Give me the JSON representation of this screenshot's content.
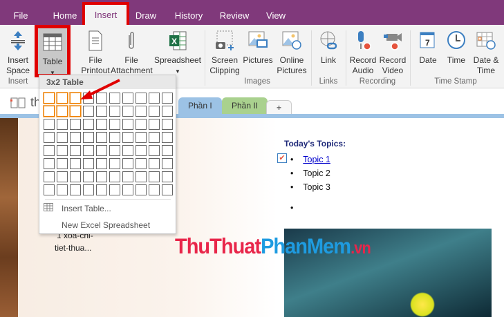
{
  "tabs": [
    "File",
    "Home",
    "Insert",
    "Draw",
    "History",
    "Review",
    "View"
  ],
  "active_tab": "Insert",
  "ribbon": {
    "buttons": {
      "insert_space": "Insert Space",
      "table": "Table",
      "file_printout": "File Printout",
      "file_attachment": "File Attachment",
      "spreadsheet": "Spreadsheet",
      "screen_clipping": "Screen Clipping",
      "pictures": "Pictures",
      "online_pictures": "Online Pictures",
      "link": "Link",
      "record_audio": "Record Audio",
      "record_video": "Record Video",
      "date": "Date",
      "time": "Time",
      "date_time": "Date & Time"
    },
    "groups": {
      "insert": "Insert",
      "images": "Images",
      "links": "Links",
      "recording": "Recording",
      "time_stamp": "Time Stamp"
    }
  },
  "notebook_title": "th",
  "sections": [
    "Phần I",
    "Phần II",
    "+"
  ],
  "dropdown": {
    "header": "3x2 Table",
    "selected_cols": 3,
    "selected_rows": 2,
    "cols": 10,
    "rows": 8,
    "insert_table": "Insert Table...",
    "new_excel": "New Excel Spreadsheet"
  },
  "page": {
    "caption_line1": "1 xoa-chi-",
    "caption_line2": "tiet-thua...",
    "topics_title": "Today's Topics:",
    "topics": [
      "Topic 1",
      "Topic 2",
      "Topic 3",
      ""
    ]
  },
  "watermark": {
    "part1": "ThuThuat",
    "part2": "PhanMem",
    "part3": ".vn"
  },
  "colors": {
    "titlebar": "#80397b",
    "highlight": "#e00000",
    "tab_blue": "#9cc2e5",
    "tab_green": "#a9d18e"
  }
}
